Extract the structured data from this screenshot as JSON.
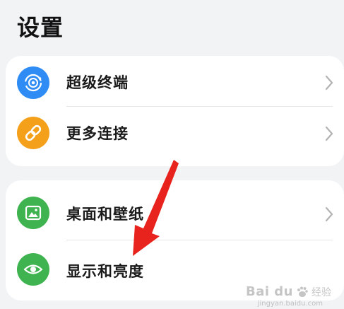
{
  "header": {
    "title": "设置"
  },
  "groups": [
    {
      "items": [
        {
          "label": "超级终端",
          "icon": "super-device-icon",
          "icon_color": "#2f8cf5"
        },
        {
          "label": "更多连接",
          "icon": "link-icon",
          "icon_color": "#f5a01a"
        }
      ]
    },
    {
      "items": [
        {
          "label": "桌面和壁纸",
          "icon": "image-icon",
          "icon_color": "#3fb34f"
        },
        {
          "label": "显示和亮度",
          "icon": "eye-icon",
          "icon_color": "#3fb34f"
        }
      ]
    }
  ],
  "annotation": {
    "color": "#e8231e",
    "points_to": "显示和亮度"
  },
  "watermark": {
    "brand": "Bai du",
    "sub": "经验",
    "url": "jingyan.baidu.com"
  }
}
